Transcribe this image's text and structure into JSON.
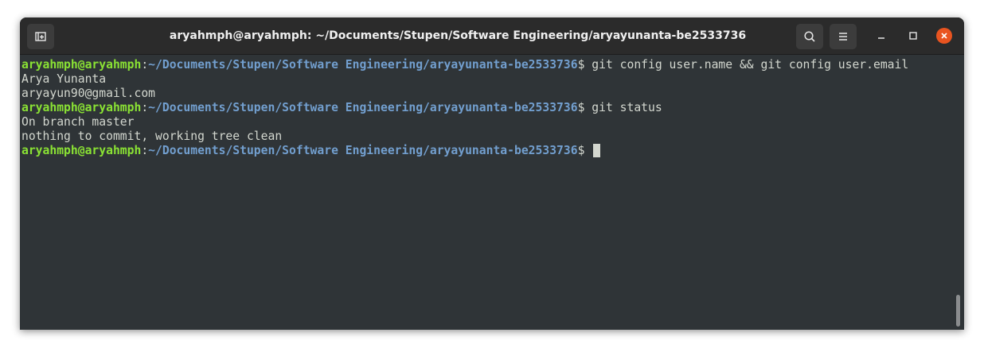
{
  "window": {
    "title": "aryahmph@aryahmph: ~/Documents/Stupen/Software Engineering/aryayunanta-be2533736"
  },
  "titlebar": {
    "new_tab_icon": "new-tab-icon",
    "search_icon": "search-icon",
    "menu_icon": "hamburger-menu-icon",
    "minimize_icon": "minimize-icon",
    "maximize_icon": "maximize-icon",
    "close_icon": "close-icon"
  },
  "colors": {
    "user_host": "#8ae234",
    "path": "#729fcf",
    "text": "#d3d7cf",
    "background": "#2f3437",
    "close_button": "#e95420"
  },
  "terminal": {
    "prompt_user": "aryahmph@aryahmph",
    "prompt_sep": ":",
    "prompt_path": "~/Documents/Stupen/Software Engineering/aryayunanta-be2533736",
    "prompt_symbol": "$ ",
    "cmd1": "git config user.name && git config user.email",
    "out1": "Arya Yunanta",
    "out2": "aryayun90@gmail.com",
    "cmd2": "git status",
    "out3": "On branch master",
    "out4": "nothing to commit, working tree clean",
    "cmd3": ""
  }
}
